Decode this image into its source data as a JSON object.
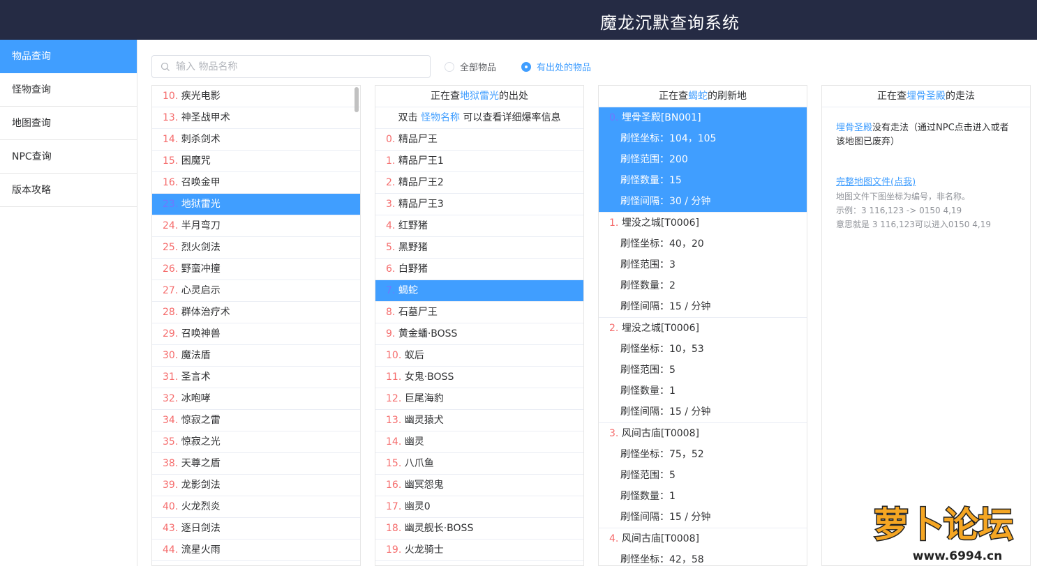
{
  "app": {
    "title": "魔龙沉默查询系统"
  },
  "sidebar": {
    "items": [
      {
        "label": "物品查询",
        "active": true
      },
      {
        "label": "怪物查询",
        "active": false
      },
      {
        "label": "地图查询",
        "active": false
      },
      {
        "label": "NPC查询",
        "active": false
      },
      {
        "label": "版本攻略",
        "active": false
      }
    ]
  },
  "search": {
    "placeholder": "输入 物品名称",
    "value": ""
  },
  "filters": {
    "all_label": "全部物品",
    "sourced_label": "有出处的物品",
    "selected": "sourced"
  },
  "items_panel": {
    "rows": [
      {
        "idx": "10",
        "name": "疾光电影"
      },
      {
        "idx": "13",
        "name": "神圣战甲术"
      },
      {
        "idx": "14",
        "name": "刺杀剑术"
      },
      {
        "idx": "15",
        "name": "困魔咒"
      },
      {
        "idx": "16",
        "name": "召唤金甲"
      },
      {
        "idx": "23",
        "name": "地狱雷光",
        "selected": true
      },
      {
        "idx": "24",
        "name": "半月弯刀"
      },
      {
        "idx": "25",
        "name": "烈火剑法"
      },
      {
        "idx": "26",
        "name": "野蛮冲撞"
      },
      {
        "idx": "27",
        "name": "心灵启示"
      },
      {
        "idx": "28",
        "name": "群体治疗术"
      },
      {
        "idx": "29",
        "name": "召唤神兽"
      },
      {
        "idx": "30",
        "name": "魔法盾"
      },
      {
        "idx": "31",
        "name": "圣言术"
      },
      {
        "idx": "32",
        "name": "冰咆哮"
      },
      {
        "idx": "34",
        "name": "惊寂之雷"
      },
      {
        "idx": "35",
        "name": "惊寂之光"
      },
      {
        "idx": "38",
        "name": "天尊之盾"
      },
      {
        "idx": "39",
        "name": "龙影剑法"
      },
      {
        "idx": "40",
        "name": "火龙烈炎"
      },
      {
        "idx": "43",
        "name": "逐日剑法"
      },
      {
        "idx": "44",
        "name": "流星火雨"
      }
    ]
  },
  "source_panel": {
    "head_prefix": "正在查",
    "head_item": "地狱雷光",
    "head_suffix": "的出处",
    "hint_prefix": "双击 ",
    "hint_link": "怪物名称",
    "hint_suffix": " 可以查看详细爆率信息",
    "rows": [
      {
        "idx": "0",
        "name": "精品尸王"
      },
      {
        "idx": "1",
        "name": "精品尸王1"
      },
      {
        "idx": "2",
        "name": "精品尸王2"
      },
      {
        "idx": "3",
        "name": "精品尸王3"
      },
      {
        "idx": "4",
        "name": "红野猪"
      },
      {
        "idx": "5",
        "name": "黑野猪"
      },
      {
        "idx": "6",
        "name": "白野猪"
      },
      {
        "idx": "7",
        "name": "蝎蛇",
        "selected": true
      },
      {
        "idx": "8",
        "name": "石墓尸王"
      },
      {
        "idx": "9",
        "name": "黄金蟠·BOSS"
      },
      {
        "idx": "10",
        "name": "蚁后"
      },
      {
        "idx": "11",
        "name": "女鬼·BOSS"
      },
      {
        "idx": "12",
        "name": "巨尾海豹"
      },
      {
        "idx": "13",
        "name": "幽灵猿犬"
      },
      {
        "idx": "14",
        "name": "幽灵"
      },
      {
        "idx": "15",
        "name": "八爪鱼"
      },
      {
        "idx": "16",
        "name": "幽冥怨鬼"
      },
      {
        "idx": "17",
        "name": "幽灵0"
      },
      {
        "idx": "18",
        "name": "幽灵舰长·BOSS"
      },
      {
        "idx": "19",
        "name": "火龙骑士"
      }
    ]
  },
  "spawn_panel": {
    "head_prefix": "正在查",
    "head_monster": "蝎蛇",
    "head_suffix": "的刷新地",
    "label_coord": "刷怪坐标：",
    "label_range": "刷怪范围：",
    "label_count": "刷怪数量：",
    "label_interval": "刷怪间隔：",
    "groups": [
      {
        "idx": "0",
        "map": "埋骨圣殿[BN001]",
        "coord": "104，105",
        "range": "200",
        "count": "15",
        "interval": "30 / 分钟",
        "selected": true
      },
      {
        "idx": "1",
        "map": "埋没之城[T0006]",
        "coord": "40，20",
        "range": "3",
        "count": "2",
        "interval": "15 / 分钟"
      },
      {
        "idx": "2",
        "map": "埋没之城[T0006]",
        "coord": "10，53",
        "range": "5",
        "count": "1",
        "interval": "15 / 分钟"
      },
      {
        "idx": "3",
        "map": "风间古庙[T0008]",
        "coord": "75，52",
        "range": "5",
        "count": "1",
        "interval": "15 / 分钟"
      },
      {
        "idx": "4",
        "map": "风间古庙[T0008]",
        "coord": "42，58"
      }
    ]
  },
  "route_panel": {
    "head_prefix": "正在查",
    "head_map": "埋骨圣殿",
    "head_suffix": "的走法",
    "body_map": "埋骨圣殿",
    "body_text": "没有走法（通过NPC点击进入或者该地图已废弃）",
    "link_label": "完整地图文件(点我)",
    "note1": "地图文件下图坐标为编号，非名称。",
    "note2": "示例：3 116,123 -> 0150 4,19",
    "note3": "意思就是 3 116,123可以进入0150 4,19"
  },
  "watermark": {
    "text": "萝卜论坛",
    "url": "www.6994.cn"
  }
}
